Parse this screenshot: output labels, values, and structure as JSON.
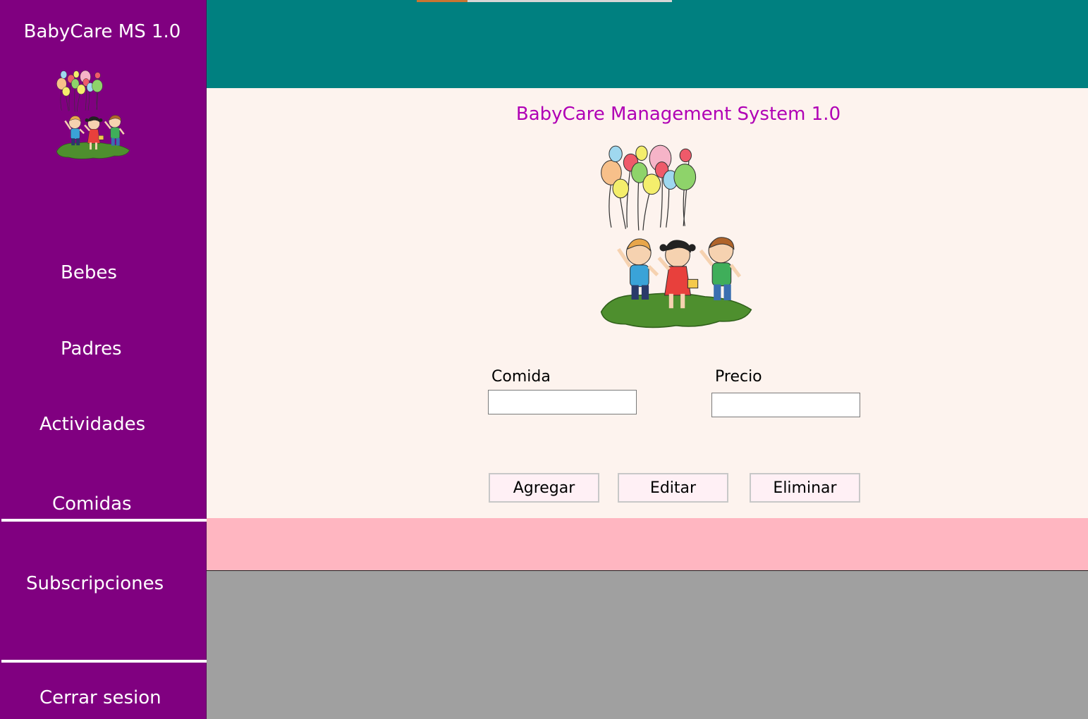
{
  "sidebar": {
    "app_title": "BabyCare MS 1.0",
    "logo_icon": "balloons-kids-logo-icon",
    "items": [
      {
        "label": "Bebes"
      },
      {
        "label": "Padres"
      },
      {
        "label": "Actividades"
      },
      {
        "label": "Comidas"
      },
      {
        "label": "Subscripciones"
      },
      {
        "label": "Cerrar sesion"
      }
    ]
  },
  "main": {
    "title": "BabyCare Management System 1.0",
    "logo_icon": "balloons-kids-logo-icon",
    "fields": {
      "comida_label": "Comida",
      "comida_value": "",
      "precio_label": "Precio",
      "precio_value": ""
    },
    "buttons": {
      "add": "Agregar",
      "edit": "Editar",
      "delete": "Eliminar"
    }
  },
  "colors": {
    "sidebar": "#800080",
    "topbar": "#008080",
    "content": "#fdf3ee",
    "title": "#b000b5",
    "footer_bar": "#ffb6c1",
    "background": "#a0a0a0"
  }
}
